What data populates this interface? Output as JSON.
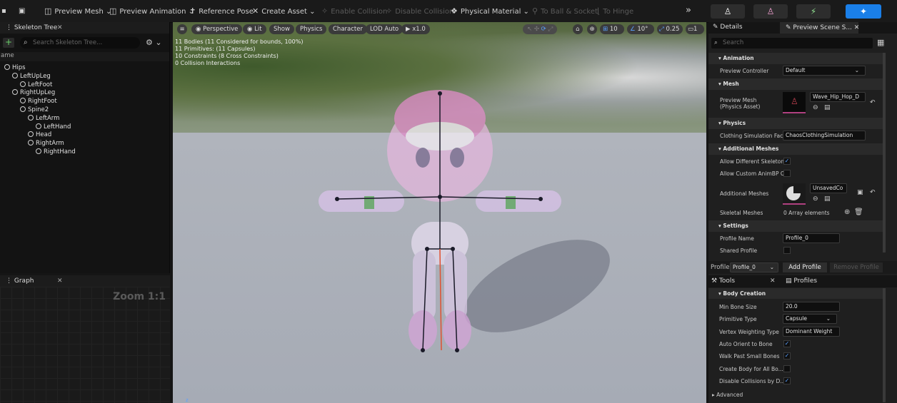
{
  "toolbar": {
    "preview_mesh": "Preview Mesh",
    "preview_animation": "Preview Animation",
    "reference_pose": "Reference Pose",
    "create_asset": "Create Asset",
    "enable_collision": "Enable Collision",
    "disable_collision": "Disable Collision",
    "physical_material": "Physical Material",
    "to_ball_socket": "To Ball & Socket",
    "to_hinge": "To Hinge"
  },
  "skeleton_tree": {
    "tab": "Skeleton Tree",
    "search_placeholder": "Search Skeleton Tree...",
    "column": "ame",
    "bones": [
      {
        "name": "Hips",
        "depth": 0
      },
      {
        "name": "LeftUpLeg",
        "depth": 1
      },
      {
        "name": "LeftFoot",
        "depth": 2
      },
      {
        "name": "RightUpLeg",
        "depth": 1
      },
      {
        "name": "RightFoot",
        "depth": 2
      },
      {
        "name": "Spine2",
        "depth": 2
      },
      {
        "name": "LeftArm",
        "depth": 3
      },
      {
        "name": "LeftHand",
        "depth": 4
      },
      {
        "name": "Head",
        "depth": 3
      },
      {
        "name": "RightArm",
        "depth": 3
      },
      {
        "name": "RightHand",
        "depth": 4
      }
    ]
  },
  "graph": {
    "tab": "Graph",
    "zoom": "Zoom 1:1"
  },
  "viewport": {
    "perspective": "Perspective",
    "lit": "Lit",
    "show": "Show",
    "physics": "Physics",
    "character": "Character",
    "lod": "LOD Auto",
    "play_speed": "x1.0",
    "grid_value": "10",
    "angle_value": "10°",
    "scale_value": "0.25",
    "camera_value": "1",
    "info": [
      "11 Bodies (11 Considered for bounds, 100%)",
      "11 Primitives: (11 Capsules)",
      "10 Constraints (8 Cross Constraints)",
      "0 Collision Interactions"
    ]
  },
  "details": {
    "tab": "Details",
    "tab2": "Preview Scene S...",
    "search_placeholder": "Search",
    "animation_section": "Animation",
    "preview_controller_label": "Preview Controller",
    "preview_controller_value": "Default",
    "mesh_section": "Mesh",
    "preview_mesh_label": "Preview Mesh",
    "preview_mesh_label2": "(Physics Asset)",
    "preview_mesh_value": "Wave_Hip_Hop_D",
    "physics_section": "Physics",
    "clothing_label": "Clothing Simulation Fact",
    "clothing_value": "ChaosClothingSimulation",
    "additional_meshes_section": "Additional Meshes",
    "allow_diff_skeleton": "Allow Different Skeleton",
    "allow_custom_animbp": "Allow Custom AnimBP O",
    "additional_meshes_label": "Additional Meshes",
    "additional_meshes_value": "UnsavedCo",
    "skeletal_meshes_label": "Skeletal Meshes",
    "skeletal_meshes_value": "0 Array elements",
    "settings_section": "Settings",
    "profile_name_label": "Profile Name",
    "profile_name_value": "Profile_0",
    "shared_profile_label": "Shared Profile",
    "profile_bar_label": "Profile",
    "profile_bar_value": "Profile_0",
    "add_profile": "Add Profile",
    "remove_profile": "Remove Profile"
  },
  "tools": {
    "tab": "Tools",
    "tab2": "Profiles",
    "body_creation_section": "Body Creation",
    "min_bone_size_label": "Min Bone Size",
    "min_bone_size_value": "20.0",
    "primitive_type_label": "Primitive Type",
    "primitive_type_value": "Capsule",
    "vertex_weighting_label": "Vertex Weighting Type",
    "vertex_weighting_value": "Dominant Weight",
    "auto_orient_label": "Auto Orient to Bone",
    "walk_past_label": "Walk Past Small Bones",
    "create_body_label": "Create Body for All Bo...",
    "disable_collisions_label": "Disable Collisions by D...",
    "advanced_label": "Advanced"
  },
  "colors": {
    "accent": "#1a7fe8",
    "selection": "#b04080"
  }
}
